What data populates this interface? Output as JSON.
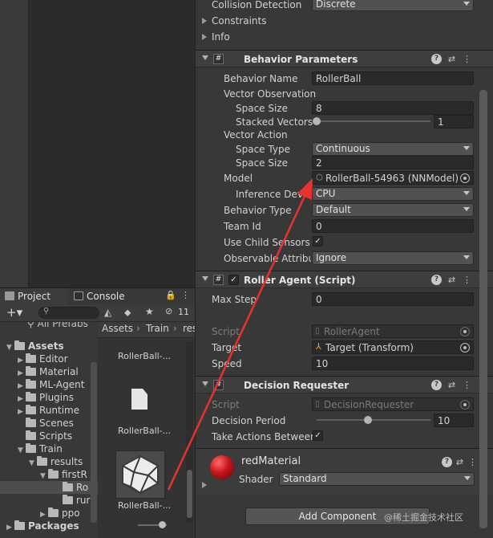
{
  "project_panel": {
    "tabs": [
      {
        "label": "Project",
        "icon": "folder-icon"
      },
      {
        "label": "Console",
        "icon": "console-icon"
      }
    ],
    "hidden_count": "11",
    "search_placeholder": "",
    "partial_row": "All Prefabs",
    "tree": [
      {
        "label": "Assets",
        "level": 0,
        "expanded": true
      },
      {
        "label": "Editor",
        "level": 1
      },
      {
        "label": "Material",
        "level": 1
      },
      {
        "label": "ML-Agent",
        "level": 1
      },
      {
        "label": "Plugins",
        "level": 1
      },
      {
        "label": "Runtime",
        "level": 1
      },
      {
        "label": "Scenes",
        "level": 1
      },
      {
        "label": "Scripts",
        "level": 1
      },
      {
        "label": "Train",
        "level": 1,
        "expanded": true
      },
      {
        "label": "results",
        "level": 2,
        "expanded": true
      },
      {
        "label": "firstR",
        "level": 3,
        "expanded": true
      },
      {
        "label": "Ro",
        "level": 4,
        "selected": true
      },
      {
        "label": "rur",
        "level": 4
      },
      {
        "label": "ppo",
        "level": 3
      },
      {
        "label": "Packages",
        "level": 0
      }
    ],
    "breadcrumb": [
      "Assets",
      "Train",
      "res"
    ],
    "assets": [
      {
        "label": "RollerBall-...",
        "kind": "top"
      },
      {
        "label": "RollerBall-...",
        "kind": "file"
      },
      {
        "label": "RollerBall-...",
        "kind": "model"
      }
    ]
  },
  "inspector": {
    "top_rows": [
      {
        "label": "Collision Detection",
        "value": "Discrete"
      },
      {
        "label": "Constraints"
      },
      {
        "label": "Info"
      }
    ],
    "behavior_parameters": {
      "title": "Behavior Parameters",
      "behavior_name_label": "Behavior Name",
      "behavior_name": "RollerBall",
      "vector_observation_label": "Vector Observation",
      "space_size_label": "Space Size",
      "obs_space_size": "8",
      "stacked_vectors_label": "Stacked Vectors",
      "stacked_vectors": "1",
      "vector_action_label": "Vector Action",
      "space_type_label": "Space Type",
      "space_type": "Continuous",
      "action_space_size": "2",
      "model_label": "Model",
      "model": "RollerBall-54963 (NNModel)",
      "inference_device_label": "Inference Device",
      "inference_device": "CPU",
      "behavior_type_label": "Behavior Type",
      "behavior_type": "Default",
      "team_id_label": "Team Id",
      "team_id": "0",
      "use_child_sensors_label": "Use Child Sensors",
      "use_child_sensors": true,
      "observable_label": "Observable Attribut",
      "observable": "Ignore"
    },
    "roller_agent": {
      "title": "Roller Agent (Script)",
      "max_step_label": "Max Step",
      "max_step": "0",
      "script_label": "Script",
      "script": "RollerAgent",
      "target_label": "Target",
      "target": "Target (Transform)",
      "speed_label": "Speed",
      "speed": "10"
    },
    "decision_requester": {
      "title": "Decision Requester",
      "script_label": "Script",
      "script": "DecisionRequester",
      "decision_period_label": "Decision Period",
      "decision_period": "10",
      "take_actions_label": "Take Actions Between",
      "take_actions": true
    },
    "material": {
      "name": "redMaterial",
      "shader_label": "Shader",
      "shader": "Standard"
    },
    "add_component_label": "Add Component",
    "watermark": "@稀土掘金技术社区"
  },
  "colors": {
    "panel_bg": "#383838",
    "field_bg": "#2a2a2a",
    "arrow": "#e8322d",
    "material_ball": "#c8161a"
  }
}
